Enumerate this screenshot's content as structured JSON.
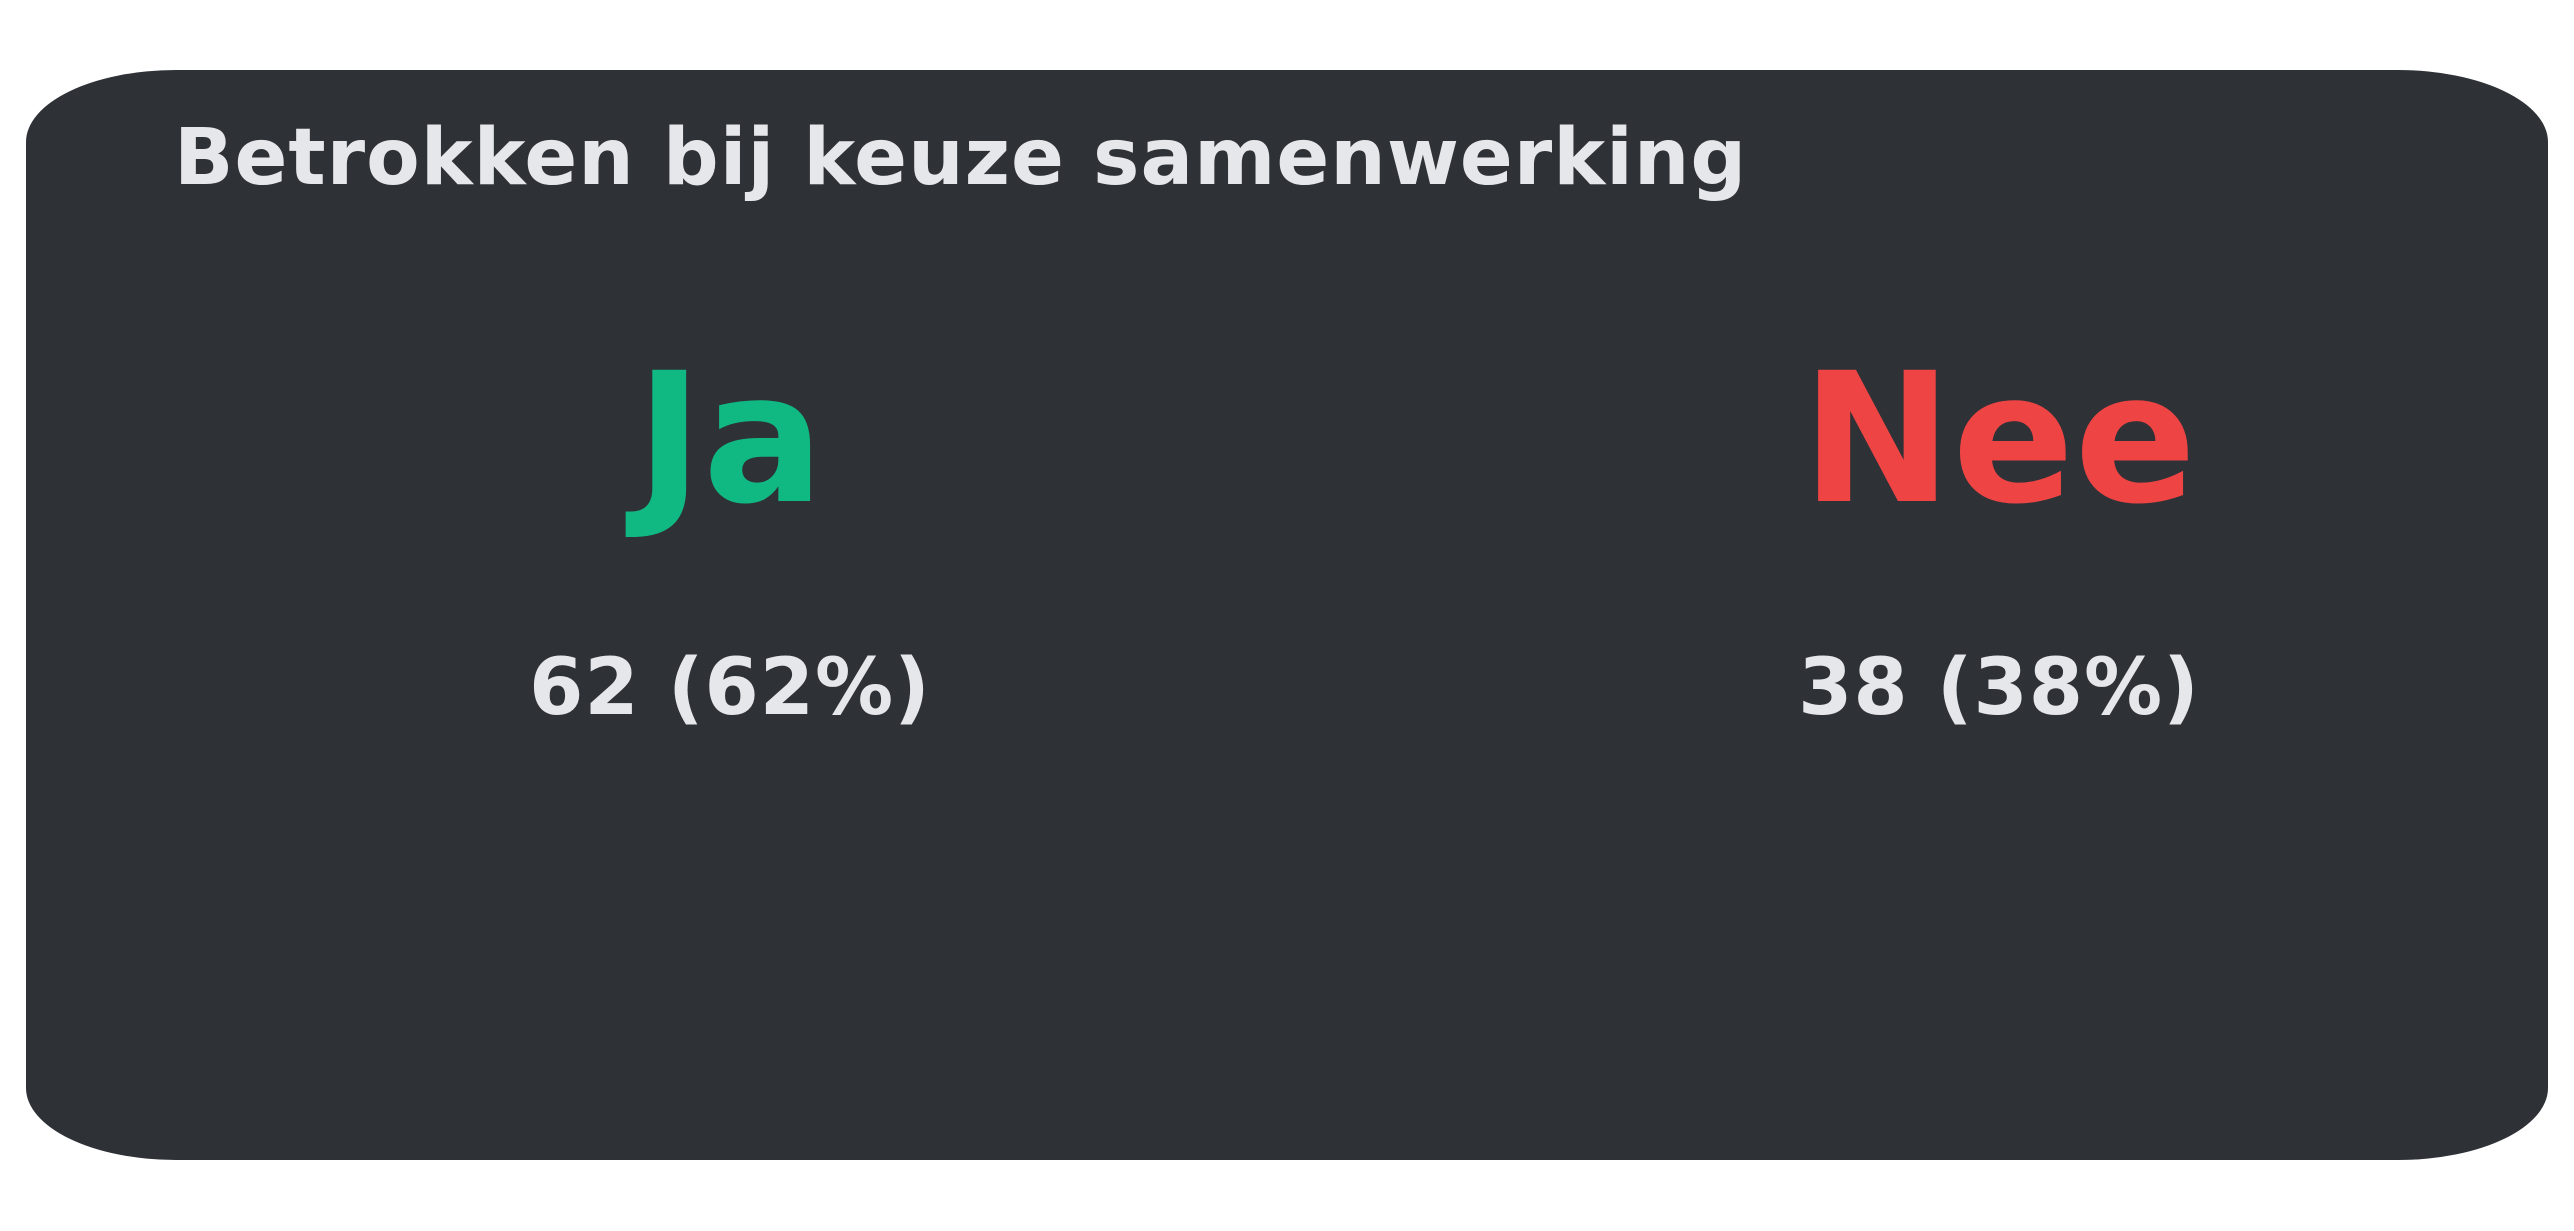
{
  "chart_data": {
    "type": "table",
    "title": "Betrokken bij keuze samenwerking",
    "categories": [
      "Ja",
      "Nee"
    ],
    "values": [
      62,
      38
    ],
    "percentages": [
      62,
      38
    ],
    "value_labels": [
      "62 (62%)",
      "38 (38%)"
    ],
    "colors": [
      "#10b981",
      "#ef4444"
    ]
  },
  "colors": {
    "background": "#ffffff",
    "card": "#2e3136",
    "text": "#e5e7eb",
    "ja": "#10b981",
    "nee": "#ef4444"
  }
}
